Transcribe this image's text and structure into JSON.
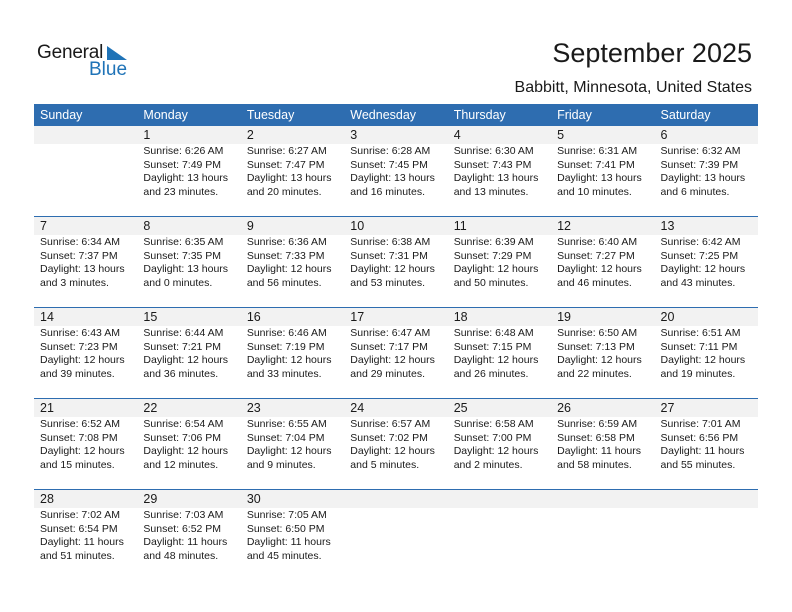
{
  "brand": {
    "general": "General",
    "blue": "Blue",
    "accent": "#1f73b7"
  },
  "header": {
    "title": "September 2025",
    "location": "Babbitt, Minnesota, United States"
  },
  "weekdays": [
    "Sunday",
    "Monday",
    "Tuesday",
    "Wednesday",
    "Thursday",
    "Friday",
    "Saturday"
  ],
  "weeks": [
    [
      null,
      {
        "day": "1",
        "sunrise": "Sunrise: 6:26 AM",
        "sunset": "Sunset: 7:49 PM",
        "daylight1": "Daylight: 13 hours",
        "daylight2": "and 23 minutes."
      },
      {
        "day": "2",
        "sunrise": "Sunrise: 6:27 AM",
        "sunset": "Sunset: 7:47 PM",
        "daylight1": "Daylight: 13 hours",
        "daylight2": "and 20 minutes."
      },
      {
        "day": "3",
        "sunrise": "Sunrise: 6:28 AM",
        "sunset": "Sunset: 7:45 PM",
        "daylight1": "Daylight: 13 hours",
        "daylight2": "and 16 minutes."
      },
      {
        "day": "4",
        "sunrise": "Sunrise: 6:30 AM",
        "sunset": "Sunset: 7:43 PM",
        "daylight1": "Daylight: 13 hours",
        "daylight2": "and 13 minutes."
      },
      {
        "day": "5",
        "sunrise": "Sunrise: 6:31 AM",
        "sunset": "Sunset: 7:41 PM",
        "daylight1": "Daylight: 13 hours",
        "daylight2": "and 10 minutes."
      },
      {
        "day": "6",
        "sunrise": "Sunrise: 6:32 AM",
        "sunset": "Sunset: 7:39 PM",
        "daylight1": "Daylight: 13 hours",
        "daylight2": "and 6 minutes."
      }
    ],
    [
      {
        "day": "7",
        "sunrise": "Sunrise: 6:34 AM",
        "sunset": "Sunset: 7:37 PM",
        "daylight1": "Daylight: 13 hours",
        "daylight2": "and 3 minutes."
      },
      {
        "day": "8",
        "sunrise": "Sunrise: 6:35 AM",
        "sunset": "Sunset: 7:35 PM",
        "daylight1": "Daylight: 13 hours",
        "daylight2": "and 0 minutes."
      },
      {
        "day": "9",
        "sunrise": "Sunrise: 6:36 AM",
        "sunset": "Sunset: 7:33 PM",
        "daylight1": "Daylight: 12 hours",
        "daylight2": "and 56 minutes."
      },
      {
        "day": "10",
        "sunrise": "Sunrise: 6:38 AM",
        "sunset": "Sunset: 7:31 PM",
        "daylight1": "Daylight: 12 hours",
        "daylight2": "and 53 minutes."
      },
      {
        "day": "11",
        "sunrise": "Sunrise: 6:39 AM",
        "sunset": "Sunset: 7:29 PM",
        "daylight1": "Daylight: 12 hours",
        "daylight2": "and 50 minutes."
      },
      {
        "day": "12",
        "sunrise": "Sunrise: 6:40 AM",
        "sunset": "Sunset: 7:27 PM",
        "daylight1": "Daylight: 12 hours",
        "daylight2": "and 46 minutes."
      },
      {
        "day": "13",
        "sunrise": "Sunrise: 6:42 AM",
        "sunset": "Sunset: 7:25 PM",
        "daylight1": "Daylight: 12 hours",
        "daylight2": "and 43 minutes."
      }
    ],
    [
      {
        "day": "14",
        "sunrise": "Sunrise: 6:43 AM",
        "sunset": "Sunset: 7:23 PM",
        "daylight1": "Daylight: 12 hours",
        "daylight2": "and 39 minutes."
      },
      {
        "day": "15",
        "sunrise": "Sunrise: 6:44 AM",
        "sunset": "Sunset: 7:21 PM",
        "daylight1": "Daylight: 12 hours",
        "daylight2": "and 36 minutes."
      },
      {
        "day": "16",
        "sunrise": "Sunrise: 6:46 AM",
        "sunset": "Sunset: 7:19 PM",
        "daylight1": "Daylight: 12 hours",
        "daylight2": "and 33 minutes."
      },
      {
        "day": "17",
        "sunrise": "Sunrise: 6:47 AM",
        "sunset": "Sunset: 7:17 PM",
        "daylight1": "Daylight: 12 hours",
        "daylight2": "and 29 minutes."
      },
      {
        "day": "18",
        "sunrise": "Sunrise: 6:48 AM",
        "sunset": "Sunset: 7:15 PM",
        "daylight1": "Daylight: 12 hours",
        "daylight2": "and 26 minutes."
      },
      {
        "day": "19",
        "sunrise": "Sunrise: 6:50 AM",
        "sunset": "Sunset: 7:13 PM",
        "daylight1": "Daylight: 12 hours",
        "daylight2": "and 22 minutes."
      },
      {
        "day": "20",
        "sunrise": "Sunrise: 6:51 AM",
        "sunset": "Sunset: 7:11 PM",
        "daylight1": "Daylight: 12 hours",
        "daylight2": "and 19 minutes."
      }
    ],
    [
      {
        "day": "21",
        "sunrise": "Sunrise: 6:52 AM",
        "sunset": "Sunset: 7:08 PM",
        "daylight1": "Daylight: 12 hours",
        "daylight2": "and 15 minutes."
      },
      {
        "day": "22",
        "sunrise": "Sunrise: 6:54 AM",
        "sunset": "Sunset: 7:06 PM",
        "daylight1": "Daylight: 12 hours",
        "daylight2": "and 12 minutes."
      },
      {
        "day": "23",
        "sunrise": "Sunrise: 6:55 AM",
        "sunset": "Sunset: 7:04 PM",
        "daylight1": "Daylight: 12 hours",
        "daylight2": "and 9 minutes."
      },
      {
        "day": "24",
        "sunrise": "Sunrise: 6:57 AM",
        "sunset": "Sunset: 7:02 PM",
        "daylight1": "Daylight: 12 hours",
        "daylight2": "and 5 minutes."
      },
      {
        "day": "25",
        "sunrise": "Sunrise: 6:58 AM",
        "sunset": "Sunset: 7:00 PM",
        "daylight1": "Daylight: 12 hours",
        "daylight2": "and 2 minutes."
      },
      {
        "day": "26",
        "sunrise": "Sunrise: 6:59 AM",
        "sunset": "Sunset: 6:58 PM",
        "daylight1": "Daylight: 11 hours",
        "daylight2": "and 58 minutes."
      },
      {
        "day": "27",
        "sunrise": "Sunrise: 7:01 AM",
        "sunset": "Sunset: 6:56 PM",
        "daylight1": "Daylight: 11 hours",
        "daylight2": "and 55 minutes."
      }
    ],
    [
      {
        "day": "28",
        "sunrise": "Sunrise: 7:02 AM",
        "sunset": "Sunset: 6:54 PM",
        "daylight1": "Daylight: 11 hours",
        "daylight2": "and 51 minutes."
      },
      {
        "day": "29",
        "sunrise": "Sunrise: 7:03 AM",
        "sunset": "Sunset: 6:52 PM",
        "daylight1": "Daylight: 11 hours",
        "daylight2": "and 48 minutes."
      },
      {
        "day": "30",
        "sunrise": "Sunrise: 7:05 AM",
        "sunset": "Sunset: 6:50 PM",
        "daylight1": "Daylight: 11 hours",
        "daylight2": "and 45 minutes."
      },
      null,
      null,
      null,
      null
    ]
  ]
}
